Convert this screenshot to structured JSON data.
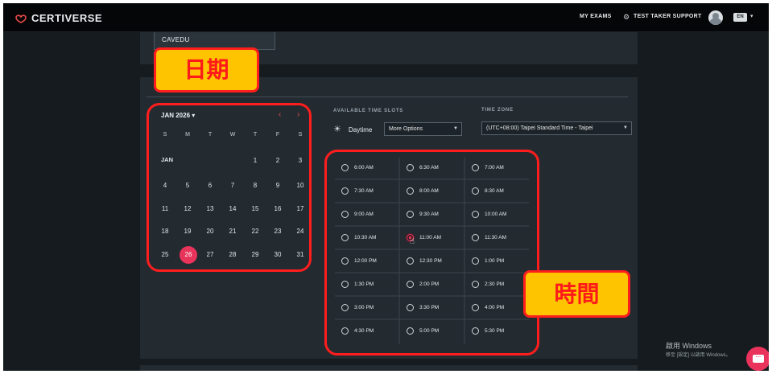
{
  "header": {
    "brand": "CERTIVERSE",
    "my_exams": "MY EXAMS",
    "support": "TEST TAKER SUPPORT",
    "language": "EN"
  },
  "previous_section": {
    "value": "CAVEDU"
  },
  "calendar": {
    "month_title": "JAN 2026",
    "weekdays": [
      "S",
      "M",
      "T",
      "W",
      "T",
      "F",
      "S"
    ],
    "month_label": "JAN",
    "weeks": [
      [
        "",
        "",
        "",
        "",
        "1",
        "2",
        "3"
      ],
      [
        "4",
        "5",
        "6",
        "7",
        "8",
        "9",
        "10"
      ],
      [
        "11",
        "12",
        "13",
        "14",
        "15",
        "16",
        "17"
      ],
      [
        "18",
        "19",
        "20",
        "21",
        "22",
        "23",
        "24"
      ],
      [
        "25",
        "26",
        "27",
        "28",
        "29",
        "30",
        "31"
      ]
    ],
    "selected_day": "26"
  },
  "time_slots": {
    "heading": "AVAILABLE TIME SLOTS",
    "period": "Daytime",
    "more_options": "More Options",
    "slots": [
      "6:00 AM",
      "6:30 AM",
      "7:00 AM",
      "7:30 AM",
      "8:00 AM",
      "8:30 AM",
      "9:00 AM",
      "9:30 AM",
      "10:00 AM",
      "10:30 AM",
      "11:00 AM",
      "11:30 AM",
      "12:00 PM",
      "12:30 PM",
      "1:00 PM",
      "1:30 PM",
      "2:00 PM",
      "2:30 PM",
      "3:00 PM",
      "3:30 PM",
      "4:00 PM",
      "4:30 PM",
      "5:00 PM",
      "5:30 PM"
    ],
    "selected_slot": "11:00 AM"
  },
  "time_zone": {
    "heading": "TIME ZONE",
    "value": "(UTC+08:00) Taipei Standard Time - Taipei"
  },
  "annotations": {
    "date_label": "日期",
    "time_label": "時間"
  },
  "windows_watermark": {
    "line1": "啟用 Windows",
    "line2": "移至 [設定] 以啟用 Windows。"
  },
  "colors": {
    "accent": "#e8335a",
    "annotation_red": "#ff1d1d",
    "annotation_yellow": "#ffc400"
  }
}
